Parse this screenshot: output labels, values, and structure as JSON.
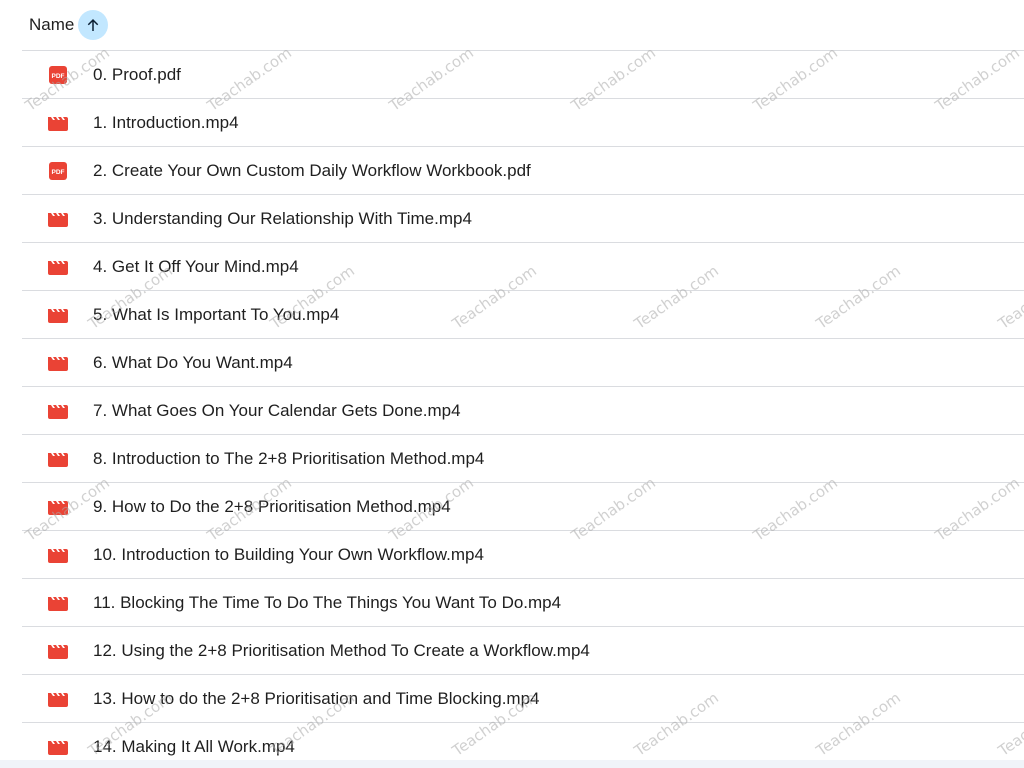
{
  "header": {
    "column_label": "Name",
    "sort_icon": "arrow-upward-icon"
  },
  "files": [
    {
      "name": "0. Proof.pdf",
      "type": "pdf"
    },
    {
      "name": "1. Introduction.mp4",
      "type": "video"
    },
    {
      "name": "2. Create Your Own Custom Daily Workflow Workbook.pdf",
      "type": "pdf"
    },
    {
      "name": "3. Understanding Our Relationship With Time.mp4",
      "type": "video"
    },
    {
      "name": "4. Get It Off Your Mind.mp4",
      "type": "video"
    },
    {
      "name": "5. What Is Important To You.mp4",
      "type": "video"
    },
    {
      "name": "6. What Do You Want.mp4",
      "type": "video"
    },
    {
      "name": "7. What Goes On Your Calendar Gets Done.mp4",
      "type": "video"
    },
    {
      "name": "8. Introduction to The 2+8 Prioritisation Method.mp4",
      "type": "video"
    },
    {
      "name": "9. How to Do the 2+8 Prioritisation Method.mp4",
      "type": "video"
    },
    {
      "name": "10. Introduction to Building Your Own Workflow.mp4",
      "type": "video"
    },
    {
      "name": "11. Blocking The Time To Do The Things You Want To Do.mp4",
      "type": "video"
    },
    {
      "name": "12. Using the 2+8 Prioritisation Method To Create a Workflow.mp4",
      "type": "video"
    },
    {
      "name": "13. How to do the 2+8 Prioritisation and Time Blocking.mp4",
      "type": "video"
    },
    {
      "name": "14. Making It All Work.mp4",
      "type": "video"
    }
  ],
  "icons": {
    "pdf": {
      "name": "pdf-icon",
      "label": "PDF",
      "color": "#ea4335"
    },
    "video": {
      "name": "video-file-icon",
      "color": "#ea4335"
    }
  },
  "colors": {
    "sort_button_bg": "#c2e7ff",
    "divider": "#dadce0",
    "text": "#1f1f1f"
  },
  "watermark": {
    "text": "Teachab.com"
  }
}
